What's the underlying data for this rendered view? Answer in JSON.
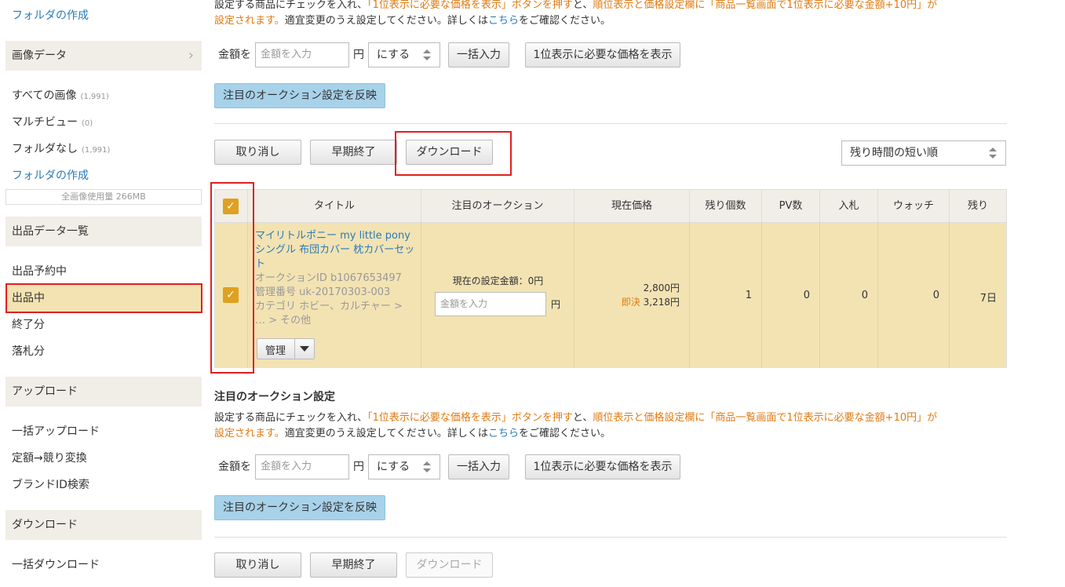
{
  "sidebar": {
    "create_folder_top": "フォルダの作成",
    "image_data_header": "画像データ",
    "all_images": {
      "label": "すべての画像",
      "count": "(1,991)"
    },
    "multi_view": {
      "label": "マルチビュー",
      "count": "(0)"
    },
    "no_folder": {
      "label": "フォルダなし",
      "count": "(1,991)"
    },
    "create_folder": "フォルダの作成",
    "usage": "全画像使用量 266MB",
    "listing_header": "出品データ一覧",
    "scheduled": "出品予約中",
    "active": "出品中",
    "ended": "終了分",
    "sold": "落札分",
    "upload_header": "アップロード",
    "bulk_upload": "一括アップロード",
    "fixed_to_auction": "定額→競り変換",
    "brand_search": "ブランドID検索",
    "download_header": "ダウンロード",
    "bulk_download": "一括ダウンロード"
  },
  "note": {
    "a": "設定する商品にチェックを入れ、",
    "b": "「1位表示に必要な価格を表示」ボタンを押す",
    "c": "と、",
    "d": "順位表示と価格設定欄に「商品一覧画面で1位表示に必要な金額+10円」が",
    "e": "設定されます。",
    "f": "適宜変更のうえ設定してください。詳しくは",
    "g": "こちら",
    "h": "をご確認ください。"
  },
  "price_form": {
    "amount_label": "金額を",
    "amount_placeholder": "金額を入力",
    "yen": "円",
    "mode": "にする",
    "bulk_input": "一括入力",
    "show_price": "1位表示に必要な価格を表示",
    "apply": "注目のオークション設定を反映"
  },
  "toolbar": {
    "cancel": "取り消し",
    "end_early": "早期終了",
    "download": "ダウンロード",
    "sort": "残り時間の短い順"
  },
  "table": {
    "headers": [
      "タイトル",
      "注目のオークション",
      "現在価格",
      "残り個数",
      "PV数",
      "入札",
      "ウォッチ",
      "残り"
    ],
    "row": {
      "title": "マイリトルポニー my little pony シングル 布団カバー 枕カバーセット",
      "auction_id": "オークションID b1067653497",
      "manage_no": "管理番号 uk-20170303-003",
      "category": "カテゴリ ホビー、カルチャー > … > その他",
      "manage_button": "管理",
      "current_setting": "現在の設定金額：0円",
      "amount_placeholder": "金額を入力",
      "yen": "円",
      "price": "2,800円",
      "buy_now_label": "即決",
      "buy_now_price": "3,218円",
      "remaining_qty": "1",
      "pv": "0",
      "bids": "0",
      "watch": "0",
      "time_left": "7日"
    }
  },
  "featured_heading": "注目のオークション設定",
  "colors": {
    "accent_red": "#e02020",
    "row_highlight": "#f3e3b3",
    "check_orange": "#e0a020",
    "link_blue": "#2a7ab8",
    "note_orange": "#e07a10"
  }
}
